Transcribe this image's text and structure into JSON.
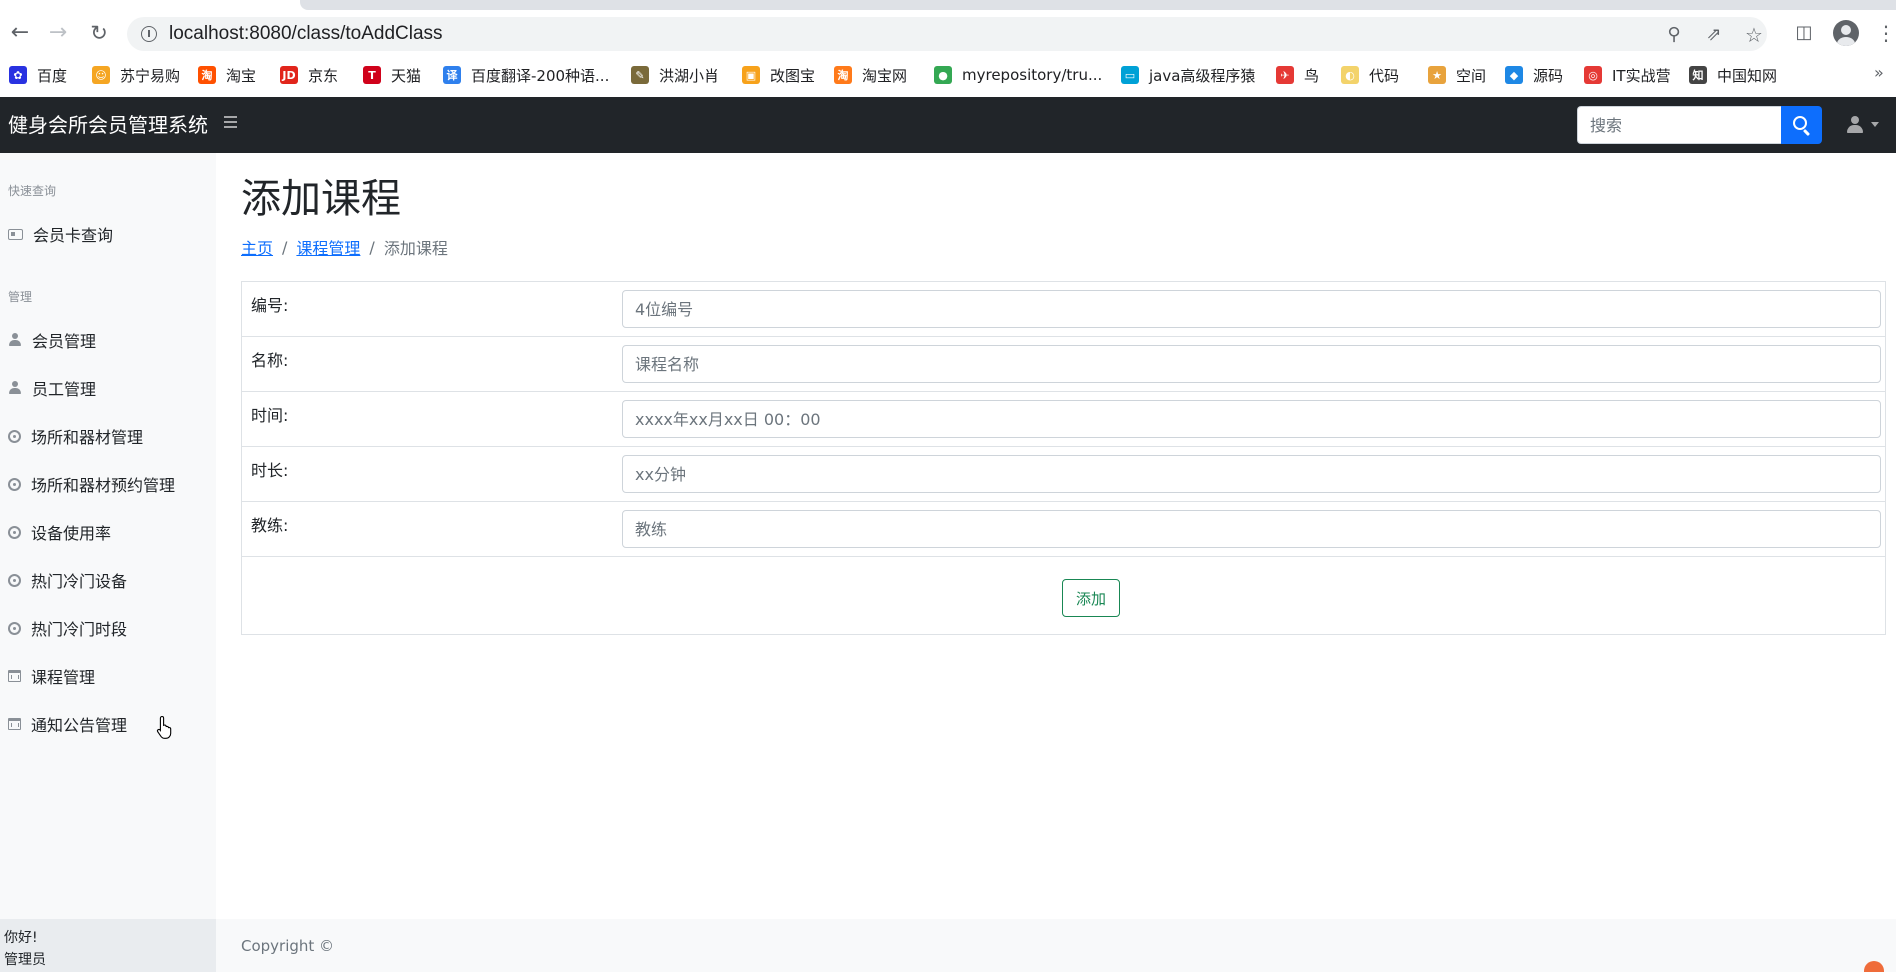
{
  "browser": {
    "url": "localhost:8080/class/toAddClass",
    "icons": {
      "back": "arrow-left-icon",
      "forward": "arrow-right-icon",
      "reload": "reload-icon",
      "info": "info-icon",
      "zoom": "zoom-icon",
      "share": "share-icon",
      "bookmark": "star-icon",
      "side_panel": "side-panel-icon",
      "profile": "profile-icon",
      "menu": "kebab-menu-icon"
    },
    "bookmarks": [
      {
        "label": "百度",
        "color": "#2932e1",
        "glyph": "✿"
      },
      {
        "label": "苏宁易购",
        "color": "#f5a623",
        "glyph": "☺"
      },
      {
        "label": "淘宝",
        "color": "#ff5000",
        "glyph": "淘"
      },
      {
        "label": "京东",
        "color": "#e1251b",
        "glyph": "JD"
      },
      {
        "label": "天猫",
        "color": "#d0021b",
        "glyph": "T"
      },
      {
        "label": "百度翻译-200种语...",
        "color": "#2f80ed",
        "glyph": "译"
      },
      {
        "label": "洪湖小肖",
        "color": "#7a6a3a",
        "glyph": "✎"
      },
      {
        "label": "改图宝",
        "color": "#f7a21b",
        "glyph": "▣"
      },
      {
        "label": "淘宝网",
        "color": "#ff7a1a",
        "glyph": "淘"
      },
      {
        "label": "myrepository/tru...",
        "color": "#34a853",
        "glyph": "●"
      },
      {
        "label": "java高级程序猿",
        "color": "#00a1d6",
        "glyph": "▭"
      },
      {
        "label": "鸟",
        "color": "#e53935",
        "glyph": "✈"
      },
      {
        "label": "代码",
        "color": "#f3d36b",
        "glyph": "◐"
      },
      {
        "label": "空间",
        "color": "#e8a33d",
        "glyph": "★"
      },
      {
        "label": "源码",
        "color": "#1e88e5",
        "glyph": "◆"
      },
      {
        "label": "IT实战营",
        "color": "#e53935",
        "glyph": "◎"
      },
      {
        "label": "中国知网",
        "color": "#444444",
        "glyph": "知"
      }
    ],
    "more_label": "»"
  },
  "navbar": {
    "brand": "健身会所会员管理系统",
    "toggle_icon": "hamburger-icon",
    "search_placeholder": "搜索",
    "search_icon": "search-icon",
    "user_icon": "user-icon"
  },
  "sidebar": {
    "sections": [
      {
        "heading": "快速查询",
        "items": [
          {
            "label": "会员卡查询",
            "icon": "id-card-icon"
          }
        ]
      },
      {
        "heading": "管理",
        "items": [
          {
            "label": "会员管理",
            "icon": "user-icon"
          },
          {
            "label": "员工管理",
            "icon": "user-tie-icon"
          },
          {
            "label": "场所和器材管理",
            "icon": "gear-icon"
          },
          {
            "label": "场所和器材预约管理",
            "icon": "gear-icon"
          },
          {
            "label": "设备使用率",
            "icon": "gear-icon"
          },
          {
            "label": "热门冷门设备",
            "icon": "gear-icon"
          },
          {
            "label": "热门冷门时段",
            "icon": "gear-icon"
          },
          {
            "label": "课程管理",
            "icon": "calendar-icon"
          },
          {
            "label": "通知公告管理",
            "icon": "calendar-icon"
          }
        ]
      }
    ],
    "footer": {
      "greeting": "你好!",
      "role": "管理员"
    }
  },
  "main": {
    "title": "添加课程",
    "breadcrumb": {
      "home": "主页",
      "section": "课程管理",
      "current": "添加课程",
      "separator": "/"
    },
    "form": {
      "fields": [
        {
          "label": "编号:",
          "placeholder": "4位编号",
          "value": ""
        },
        {
          "label": "名称:",
          "placeholder": "课程名称",
          "value": ""
        },
        {
          "label": "时间:",
          "placeholder": "xxxx年xx月xx日 00：00",
          "value": ""
        },
        {
          "label": "时长:",
          "placeholder": "xx分钟",
          "value": ""
        },
        {
          "label": "教练:",
          "placeholder": "教练",
          "value": ""
        }
      ],
      "submit_label": "添加"
    },
    "footer": {
      "copyright": "Copyright ©"
    }
  },
  "colors": {
    "navbar_bg": "#212529",
    "sidebar_bg": "#f8f9fa",
    "primary": "#0d6efd",
    "success": "#198754"
  }
}
